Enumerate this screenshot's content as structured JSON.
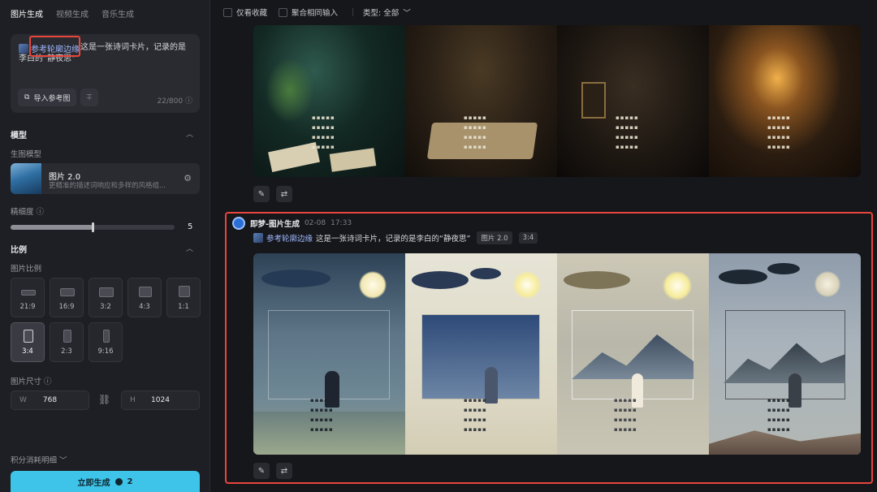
{
  "sidebar": {
    "tabs": [
      {
        "label": "图片生成",
        "active": true
      },
      {
        "label": "视频生成",
        "active": false
      },
      {
        "label": "音乐生成",
        "active": false
      }
    ],
    "prompt": {
      "reference_chip": "参考轮廓边缘",
      "text": "这是一张诗词卡片，记录的是李白的“静夜思”",
      "import_button": "导入参考图",
      "counter": "22/800"
    },
    "model_section": {
      "title": "模型",
      "label": "生图模型",
      "model_name": "图片 2.0",
      "model_desc": "更精准的描述词响应和多样的风格组..."
    },
    "precision": {
      "label": "精细度",
      "value": "5",
      "level_fraction": 0.5
    },
    "ratio_section": {
      "title": "比例",
      "label": "图片比例",
      "options": [
        "21:9",
        "16:9",
        "3:2",
        "4:3",
        "1:1",
        "3:4",
        "2:3",
        "9:16"
      ],
      "selected": "3:4"
    },
    "size": {
      "label": "图片尺寸",
      "w_prefix": "W",
      "w_value": "768",
      "h_prefix": "H",
      "h_value": "1024"
    },
    "credits_label": "积分消耗明细",
    "generate_button": "立即生成",
    "generate_cost": "2"
  },
  "topbar": {
    "only_favorites": "仅看收藏",
    "merge_same_input": "聚合相同输入",
    "type_filter": "类型: 全部"
  },
  "generation": {
    "title": "即梦-图片生成",
    "date": "02-08",
    "time": "17:33",
    "reference_chip": "参考轮廓边缘",
    "prompt": "这是一张诗词卡片，记录的是李白的“静夜思”",
    "model_tag": "图片 2.0",
    "ratio_tag": "3:4"
  },
  "colors": {
    "accent": "#3ec4e8",
    "highlight_red": "#e8453c",
    "link_blue": "#9fb8ff"
  },
  "icons": [
    "image-import-icon",
    "clear-icon",
    "settings-sliders-icon",
    "link-icon",
    "edit-icon",
    "regenerate-icon",
    "coin-icon",
    "chevron-down-icon",
    "chevron-up-icon",
    "info-icon"
  ]
}
